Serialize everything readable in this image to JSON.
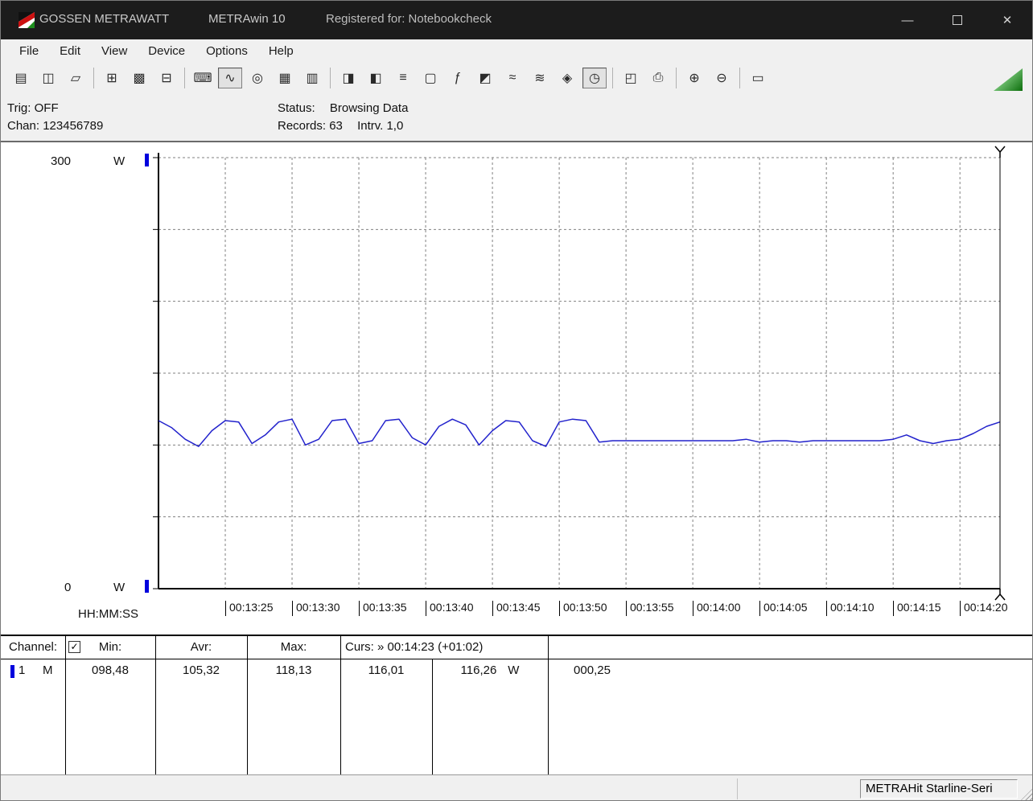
{
  "window": {
    "brand": "GOSSEN METRAWATT",
    "app": "METRAwin 10",
    "registered": "Registered for: Notebookcheck",
    "minimize_glyph": "—",
    "close_glyph": "✕"
  },
  "menu": {
    "items": [
      "File",
      "Edit",
      "View",
      "Device",
      "Options",
      "Help"
    ]
  },
  "toolbar": {
    "groups": [
      [
        {
          "name": "file-new-icon",
          "glyph": "▤"
        },
        {
          "name": "file-save-icon",
          "glyph": "◫"
        },
        {
          "name": "file-open-icon",
          "glyph": "▱"
        }
      ],
      [
        {
          "name": "export-icon",
          "glyph": "⊞"
        },
        {
          "name": "snapshot-icon",
          "glyph": "▩"
        },
        {
          "name": "copy-page-icon",
          "glyph": "⊟"
        }
      ],
      [
        {
          "name": "numeric-display-icon",
          "glyph": "⌨"
        },
        {
          "name": "chart-view-icon",
          "glyph": "∿",
          "pressed": true
        },
        {
          "name": "scope-view-icon",
          "glyph": "◎"
        },
        {
          "name": "table-view-icon",
          "glyph": "▦"
        },
        {
          "name": "scale-settings-icon",
          "glyph": "▥"
        }
      ],
      [
        {
          "name": "device-read-icon",
          "glyph": "◨"
        },
        {
          "name": "device-write-icon",
          "glyph": "◧"
        },
        {
          "name": "device-list-icon",
          "glyph": "≡"
        },
        {
          "name": "pc-monitor-icon",
          "glyph": "▢"
        },
        {
          "name": "function-icon",
          "glyph": "ƒ"
        },
        {
          "name": "device-display-icon",
          "glyph": "◩"
        },
        {
          "name": "signal-live-icon",
          "glyph": "≈"
        },
        {
          "name": "signal-log-icon",
          "glyph": "≋"
        },
        {
          "name": "overlay-icon",
          "glyph": "◈"
        },
        {
          "name": "timer-icon",
          "glyph": "◷",
          "pressed": true
        }
      ],
      [
        {
          "name": "print-preview-icon",
          "glyph": "◰"
        },
        {
          "name": "print-icon",
          "glyph": "⎙"
        }
      ],
      [
        {
          "name": "zoom-in-icon",
          "glyph": "⊕"
        },
        {
          "name": "zoom-out-icon",
          "glyph": "⊖"
        }
      ],
      [
        {
          "name": "annotation-icon",
          "glyph": "▭"
        }
      ]
    ]
  },
  "infobar": {
    "trig_label": "Trig:",
    "trig_value": "OFF",
    "chan_label": "Chan:",
    "chan_value": "123456789",
    "status_label": "Status:",
    "status_value": "Browsing Data",
    "records_label": "Records:",
    "records_value": "63",
    "intrv_label": "Intrv.",
    "intrv_value": "1,0"
  },
  "chart_data": {
    "type": "line",
    "title": "",
    "ylabel_unit": "W",
    "y_max_label": "300",
    "y_min_label": "0",
    "ylim": [
      0,
      300
    ],
    "xlim_seconds": [
      0,
      63
    ],
    "x_axis_label": "HH:MM:SS",
    "x_start_time": "00:13:20",
    "grid": "dashed",
    "y_gridlines": [
      50,
      100,
      150,
      200,
      250,
      300
    ],
    "x_ticks": [
      {
        "t": 5,
        "label": "00:13:25"
      },
      {
        "t": 10,
        "label": "00:13:30"
      },
      {
        "t": 15,
        "label": "00:13:35"
      },
      {
        "t": 20,
        "label": "00:13:40"
      },
      {
        "t": 25,
        "label": "00:13:45"
      },
      {
        "t": 30,
        "label": "00:13:50"
      },
      {
        "t": 35,
        "label": "00:13:55"
      },
      {
        "t": 40,
        "label": "00:14:00"
      },
      {
        "t": 45,
        "label": "00:14:05"
      },
      {
        "t": 50,
        "label": "00:14:10"
      },
      {
        "t": 55,
        "label": "00:14:15"
      },
      {
        "t": 60,
        "label": "00:14:20"
      }
    ],
    "cursor": {
      "t": 63,
      "time_label": "00:14:23"
    },
    "series": [
      {
        "name": "channel-1-power",
        "color": "#2222cc",
        "x_step_seconds": 1,
        "values": [
          117,
          112,
          104,
          99,
          110,
          117,
          116,
          101,
          107,
          116,
          118,
          100,
          104,
          117,
          118,
          101,
          103,
          117,
          118,
          105,
          100,
          113,
          118,
          114,
          100,
          110,
          117,
          116,
          103,
          99,
          116,
          118,
          117,
          102,
          103,
          103,
          103,
          103,
          103,
          103,
          103,
          103,
          103,
          103,
          104,
          102,
          103,
          103,
          102,
          103,
          103,
          103,
          103,
          103,
          103,
          104,
          107,
          103,
          101,
          103,
          104,
          108,
          113,
          116
        ]
      }
    ]
  },
  "table": {
    "header": {
      "channel": "Channel:",
      "check_glyph": "✓",
      "min": "Min:",
      "avr": "Avr:",
      "max": "Max:",
      "curs": "Curs: » 00:14:23 (+01:02)"
    },
    "row": {
      "channel": "1",
      "mode": "M",
      "min": "098,48",
      "avr": "105,32",
      "max": "118,13",
      "curs_value": "116,01",
      "curs_value2": "116,26",
      "unit": "W",
      "delta": "000,25"
    }
  },
  "statusbar": {
    "device": "METRAHit Starline-Seri"
  },
  "colors": {
    "accent_blue": "#2222cc",
    "channel_marker": "#0000dd",
    "titlebar_bg": "#1c1c1c",
    "panel_bg": "#f0f0f0",
    "grid_gray": "#808080",
    "logo_green": "#1e8f1e"
  }
}
